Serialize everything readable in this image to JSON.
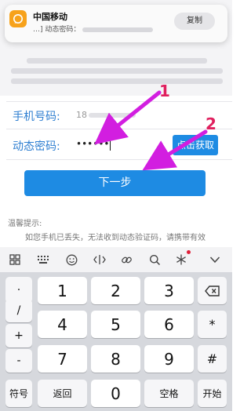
{
  "notification": {
    "app_name": "中国移动",
    "message": "…] 动态密码：",
    "copy_label": "复制"
  },
  "form": {
    "phone_label": "手机号码:",
    "phone_value": "18",
    "code_label": "动态密码:",
    "code_value": "••••••",
    "get_code_label": "点击获取",
    "next_label": "下一步"
  },
  "tips": {
    "title": "温馨提示:",
    "line1": "如您手机已丢失，无法收到动态验证码，请携带有效"
  },
  "annotations": {
    "arrow1": "1",
    "arrow2": "2"
  },
  "keyboard": {
    "toolbar_icons": [
      "grid-icon",
      "keyboard-icon",
      "emoji-icon",
      "cursor-icon",
      "link-icon",
      "search-icon",
      "snowflake-icon",
      "collapse-icon"
    ],
    "symbols": [
      "·",
      "/",
      "+",
      "-"
    ],
    "digits": [
      "1",
      "2",
      "3",
      "4",
      "5",
      "6",
      "7",
      "8",
      "9",
      "0"
    ],
    "delete_icon": "backspace-icon",
    "right_keys": [
      "*",
      "#"
    ],
    "bottom": {
      "sym": "符号",
      "back": "返回",
      "space": "空格",
      "start": "开始"
    }
  },
  "colors": {
    "accent": "#1e8be3",
    "arrow": "#d21ee0",
    "label": "#2f7fd1"
  }
}
